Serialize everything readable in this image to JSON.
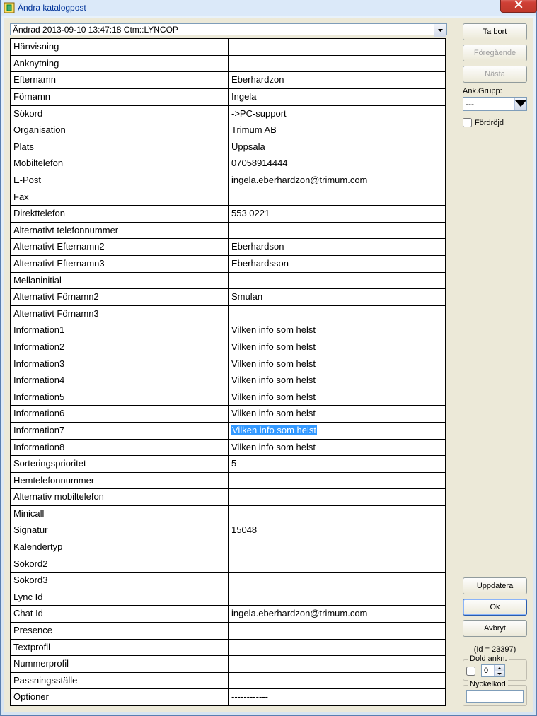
{
  "window": {
    "title": "Ändra katalogpost"
  },
  "combo": {
    "value": "Ändrad 2013-09-10 13:47:18 Ctm::LYNCOP"
  },
  "rows": [
    {
      "label": "Hänvisning",
      "value": ""
    },
    {
      "label": "Anknytning",
      "value": ""
    },
    {
      "label": "Efternamn",
      "value": "Eberhardzon"
    },
    {
      "label": "Förnamn",
      "value": "Ingela"
    },
    {
      "label": "Sökord",
      "value": "->PC-support"
    },
    {
      "label": "Organisation",
      "value": "Trimum AB"
    },
    {
      "label": "Plats",
      "value": "Uppsala"
    },
    {
      "label": "Mobiltelefon",
      "value": "07058914444"
    },
    {
      "label": "E-Post",
      "value": "ingela.eberhardzon@trimum.com"
    },
    {
      "label": "Fax",
      "value": ""
    },
    {
      "label": "Direkttelefon",
      "value": "553 0221"
    },
    {
      "label": "Alternativt telefonnummer",
      "value": ""
    },
    {
      "label": "Alternativt Efternamn2",
      "value": "Eberhardson"
    },
    {
      "label": "Alternativt Efternamn3",
      "value": "Eberhardsson"
    },
    {
      "label": "Mellaninitial",
      "value": ""
    },
    {
      "label": "Alternativt Förnamn2",
      "value": "Smulan"
    },
    {
      "label": "Alternativt Förnamn3",
      "value": ""
    },
    {
      "label": "Information1",
      "value": "Vilken info som helst"
    },
    {
      "label": "Information2",
      "value": "Vilken info som helst"
    },
    {
      "label": "Information3",
      "value": "Vilken info som helst"
    },
    {
      "label": "Information4",
      "value": "Vilken info som helst"
    },
    {
      "label": "Information5",
      "value": "Vilken info som helst"
    },
    {
      "label": "Information6",
      "value": "Vilken info som helst"
    },
    {
      "label": "Information7",
      "value": "Vilken info som helst",
      "selected": true
    },
    {
      "label": "Information8",
      "value": "Vilken info som helst"
    },
    {
      "label": "Sorteringsprioritet",
      "value": "5"
    },
    {
      "label": "Hemtelefonnummer",
      "value": ""
    },
    {
      "label": "Alternativ mobiltelefon",
      "value": ""
    },
    {
      "label": "Minicall",
      "value": ""
    },
    {
      "label": "Signatur",
      "value": "15048"
    },
    {
      "label": "Kalendertyp",
      "value": ""
    },
    {
      "label": "Sökord2",
      "value": ""
    },
    {
      "label": "Sökord3",
      "value": ""
    },
    {
      "label": "Lync Id",
      "value": ""
    },
    {
      "label": "Chat Id",
      "value": "ingela.eberhardzon@trimum.com"
    },
    {
      "label": "Presence",
      "value": ""
    },
    {
      "label": "Textprofil",
      "value": ""
    },
    {
      "label": "Nummerprofil",
      "value": ""
    },
    {
      "label": "Passningsställe",
      "value": ""
    },
    {
      "label": "Optioner",
      "value": "------------"
    }
  ],
  "buttons": {
    "tabort": "Ta bort",
    "foregaende": "Föregående",
    "nasta": "Nästa",
    "uppdatera": "Uppdatera",
    "ok": "Ok",
    "avbryt": "Avbryt"
  },
  "right": {
    "ank_grupp_label": "Ank.Grupp:",
    "ank_grupp_value": "---",
    "fordrojd": "Fördröjd",
    "id_label": "(Id = 23397)",
    "dold_ankn_legend": "Dold ankn.",
    "dold_spin": "0",
    "nyckelkod_legend": "Nyckelkod"
  }
}
